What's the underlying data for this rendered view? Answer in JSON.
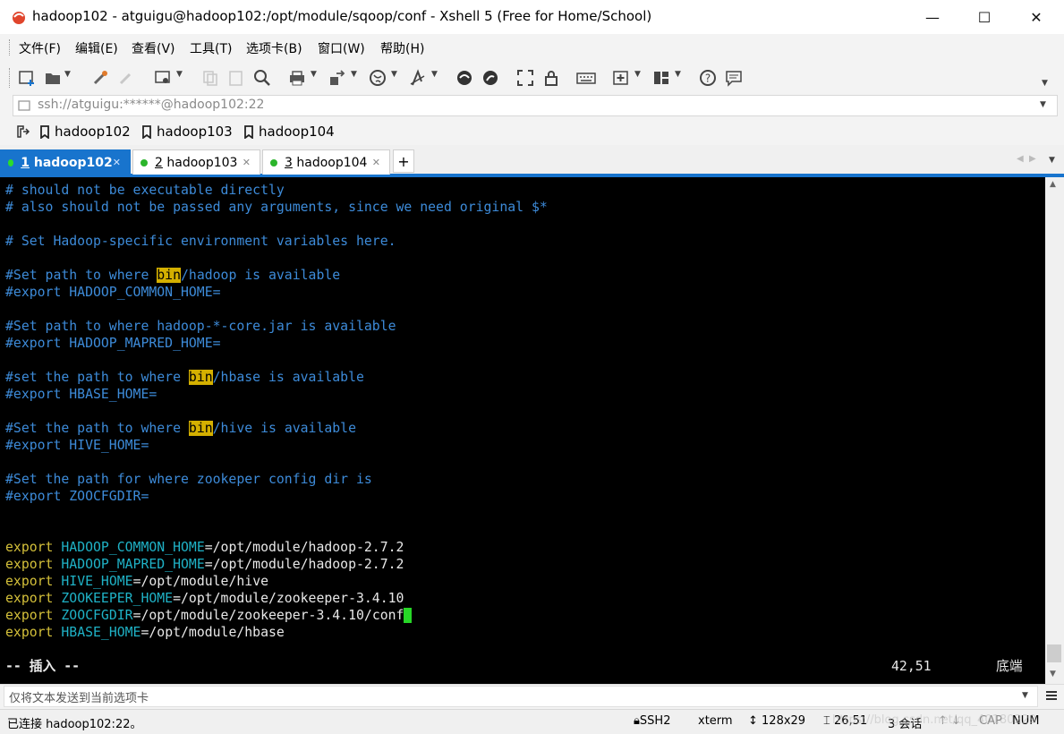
{
  "window": {
    "title": "hadoop102 - atguigu@hadoop102:/opt/module/sqoop/conf - Xshell 5 (Free for Home/School)",
    "controls": {
      "minimize": "—",
      "maximize": "☐",
      "close": "✕"
    }
  },
  "menu": [
    "文件(F)",
    "编辑(E)",
    "查看(V)",
    "工具(T)",
    "选项卡(B)",
    "窗口(W)",
    "帮助(H)"
  ],
  "toolbar": {
    "icons": [
      "new-session-icon",
      "open-folder-icon",
      "reconnect-icon",
      "disconnect-icon",
      "properties-icon",
      "copy-icon",
      "paste-icon",
      "find-icon",
      "print-icon",
      "transfer-icon",
      "globe-icon",
      "font-icon",
      "xftp-icon",
      "xmanager-icon",
      "fullscreen-icon",
      "lock-icon",
      "keyboard-icon",
      "new-tab-icon",
      "layout-icon",
      "help-icon",
      "chat-icon"
    ]
  },
  "address": {
    "value": "ssh://atguigu:******@hadoop102:22"
  },
  "links": [
    "hadoop102",
    "hadoop103",
    "hadoop104"
  ],
  "tabs": [
    {
      "num": "1",
      "label": "hadoop102",
      "active": true
    },
    {
      "num": "2",
      "label": "hadoop103",
      "active": false
    },
    {
      "num": "3",
      "label": "hadoop104",
      "active": false
    }
  ],
  "add_tab": "+",
  "terminal": {
    "lines": {
      "l1": "# should not be executable directly",
      "l2": "# also should not be passed any arguments, since we need original $*",
      "l3": "# Set Hadoop-specific environment variables here.",
      "l4a": "#Set path to where ",
      "l4b": "bin",
      "l4c": "/hadoop is available",
      "l5": "#export HADOOP_COMMON_HOME=",
      "l6": "#Set path to where hadoop-*-core.jar is available",
      "l7": "#export HADOOP_MAPRED_HOME=",
      "l8a": "#set the path to where ",
      "l8b": "bin",
      "l8c": "/hbase is available",
      "l9": "#export HBASE_HOME=",
      "l10a": "#Set the path to where ",
      "l10b": "bin",
      "l10c": "/hive is available",
      "l11": "#export HIVE_HOME=",
      "l12": "#Set the path for where zookeper config dir is",
      "l13": "#export ZOOCFGDIR=",
      "e1v": "HADOOP_COMMON_HOME",
      "e1p": "=/opt/module/hadoop-2.7.2",
      "e2v": "HADOOP_MAPRED_HOME",
      "e2p": "=/opt/module/hadoop-2.7.2",
      "e3v": "HIVE_HOME",
      "e3p": "=/opt/module/hive",
      "e4v": "ZOOKEEPER_HOME",
      "e4p": "=/opt/module/zookeeper-3.4.10",
      "e5v": "ZOOCFGDIR",
      "e5p": "=/opt/module/zookeeper-3.4.10/conf",
      "e6v": "HBASE_HOME",
      "e6p": "=/opt/module/hbase",
      "export": "export"
    },
    "mode": "-- 插入 --",
    "position": "42,51",
    "scroll": "底端"
  },
  "compose": {
    "placeholder": "仅将文本发送到当前选项卡"
  },
  "status": {
    "connection": "已连接 hadoop102:22。",
    "protocol": "SSH2",
    "term": "xterm",
    "size": "128x29",
    "cursor": "26,51",
    "sessions": "3 会话",
    "cap": "CAP",
    "num": "NUM",
    "watermark": "https://blog.csdn.net/qq_40180229"
  }
}
